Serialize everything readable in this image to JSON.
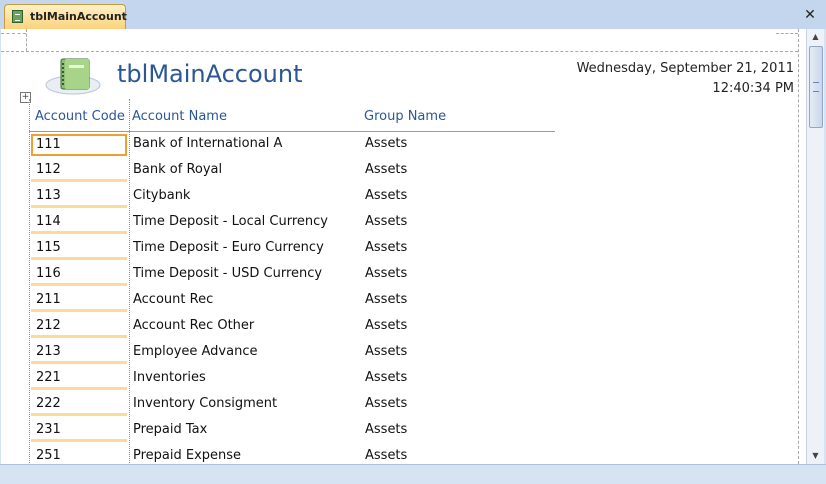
{
  "tab": {
    "title": "tblMainAccount"
  },
  "window": {
    "close_glyph": "✕"
  },
  "report": {
    "title": "tblMainAccount",
    "date": "Wednesday, September 21, 2011",
    "time": "12:40:34 PM"
  },
  "columns": {
    "code": "Account Code",
    "name": "Account Name",
    "group": "Group Name"
  },
  "rows": [
    {
      "code": "111",
      "name": "Bank of International A",
      "group": "Assets"
    },
    {
      "code": "112",
      "name": "Bank of Royal",
      "group": "Assets"
    },
    {
      "code": "113",
      "name": "Citybank",
      "group": "Assets"
    },
    {
      "code": "114",
      "name": "Time Deposit - Local Currency",
      "group": "Assets"
    },
    {
      "code": "115",
      "name": "Time Deposit - Euro Currency",
      "group": "Assets"
    },
    {
      "code": "116",
      "name": "Time Deposit - USD Currency",
      "group": "Assets"
    },
    {
      "code": "211",
      "name": "Account Rec",
      "group": "Assets"
    },
    {
      "code": "212",
      "name": "Account Rec Other",
      "group": "Assets"
    },
    {
      "code": "213",
      "name": "Employee Advance",
      "group": "Assets"
    },
    {
      "code": "221",
      "name": "Inventories",
      "group": "Assets"
    },
    {
      "code": "222",
      "name": "Inventory Consigment",
      "group": "Assets"
    },
    {
      "code": "231",
      "name": "Prepaid Tax",
      "group": "Assets"
    },
    {
      "code": "251",
      "name": "Prepaid Expense",
      "group": "Assets"
    }
  ],
  "icons": {
    "tab": "table-icon",
    "logo": "notebook-icon",
    "move": "move-handle-icon",
    "scroll_up": "scroll-up-arrow",
    "scroll_down": "scroll-down-arrow"
  },
  "colors": {
    "accent": "#2b5797",
    "tab_active": "#fbd27c",
    "selection": "#f0a030",
    "chrome": "#d6e3f3"
  }
}
